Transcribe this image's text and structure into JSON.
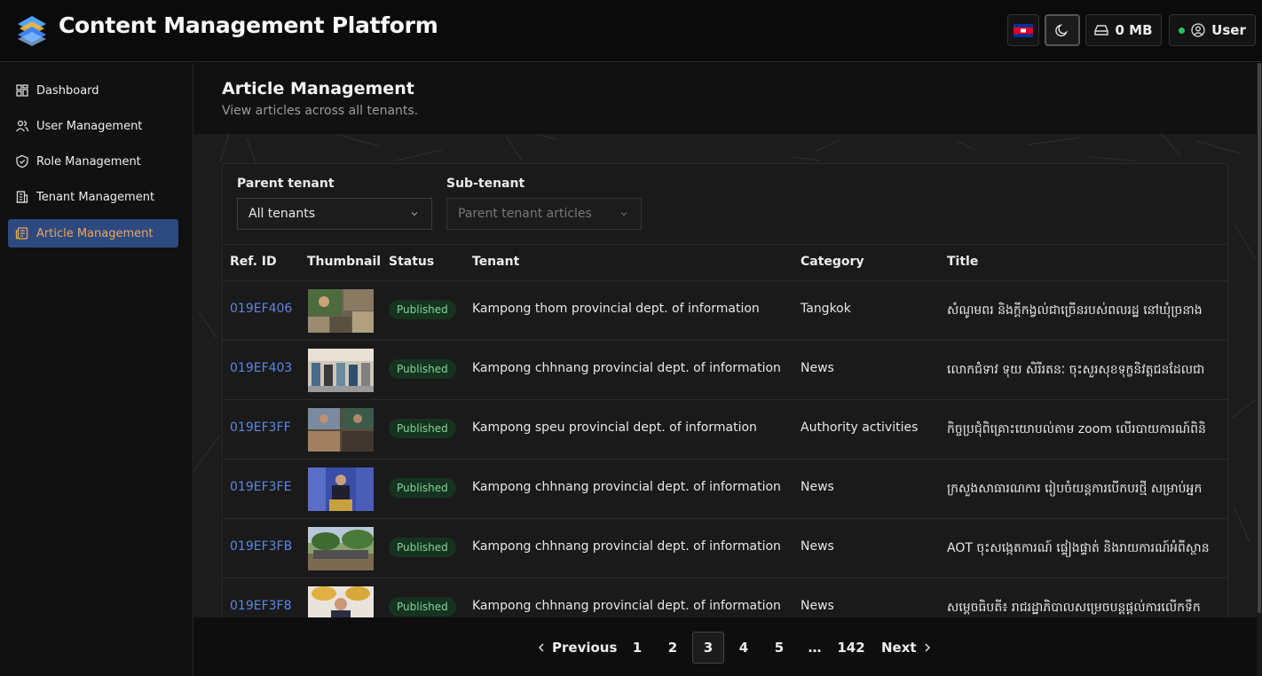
{
  "header": {
    "title": "Content Management Platform",
    "storage": "0 MB",
    "user": "User",
    "status_color": "#22c55e"
  },
  "sidebar": {
    "items": [
      {
        "label": "Dashboard",
        "icon": "dashboard-icon"
      },
      {
        "label": "User Management",
        "icon": "users-icon"
      },
      {
        "label": "Role Management",
        "icon": "shield-icon"
      },
      {
        "label": "Tenant Management",
        "icon": "building-icon"
      },
      {
        "label": "Article Management",
        "icon": "article-icon",
        "active": true
      }
    ]
  },
  "page": {
    "title": "Article Management",
    "subtitle": "View articles across all tenants."
  },
  "filters": {
    "parent_label": "Parent tenant",
    "parent_value": "All tenants",
    "sub_label": "Sub-tenant",
    "sub_value": "Parent tenant articles"
  },
  "table": {
    "columns": [
      "Ref. ID",
      "Thumbnail",
      "Status",
      "Tenant",
      "Category",
      "Title"
    ],
    "rows": [
      {
        "ref": "019EF406",
        "status": "Published",
        "tenant": "Kampong thom provincial dept. of information",
        "category": "Tangkok",
        "title": "សំណូមពរ និងក្តីកង្វល់ជាច្រើនរបស់ពលរដ្ឋ នៅឃុំច្រនាង"
      },
      {
        "ref": "019EF403",
        "status": "Published",
        "tenant": "Kampong chhnang provincial dept. of information",
        "category": "News",
        "title": "លោកជំទាវ ទុយ សិរីរតនៈ ចុះសួរសុខទុក្ខនិវត្តជនដែលជា"
      },
      {
        "ref": "019EF3FF",
        "status": "Published",
        "tenant": "Kampong speu provincial dept. of information",
        "category": "Authority activities",
        "title": "កិច្ចប្រជុំពិគ្រោះយោបល់តាម zoom លើរបាយការណ៍ពិនិ"
      },
      {
        "ref": "019EF3FE",
        "status": "Published",
        "tenant": "Kampong chhnang provincial dept. of information",
        "category": "News",
        "title": "ក្រសួងសាធារណការ រៀបចំយន្តការបើកបរថ្មី សម្រាប់អ្នក"
      },
      {
        "ref": "019EF3FB",
        "status": "Published",
        "tenant": "Kampong chhnang provincial dept. of information",
        "category": "News",
        "title": "AOT ចុះសង្កេតការណ៍ ផ្ទៀងផ្ទាត់ និងរាយការណ៍អំពីស្ថាន"
      },
      {
        "ref": "019EF3F8",
        "status": "Published",
        "tenant": "Kampong chhnang provincial dept. of information",
        "category": "News",
        "title": "សម្តេចធិបតី៖ រាជរដ្ឋាភិបាលសម្រេចបន្តផ្តល់ការលើកទឹក"
      }
    ]
  },
  "pagination": {
    "previous": "Previous",
    "pages": [
      "1",
      "2",
      "3",
      "4",
      "5"
    ],
    "current": "3",
    "ellipsis": "…",
    "last": "142",
    "next": "Next"
  },
  "colors": {
    "accent": "#2c4a80",
    "active_text": "#f0a35a",
    "link": "#5b86e5",
    "published_bg": "#16331f",
    "published_text": "#7fd39b"
  }
}
